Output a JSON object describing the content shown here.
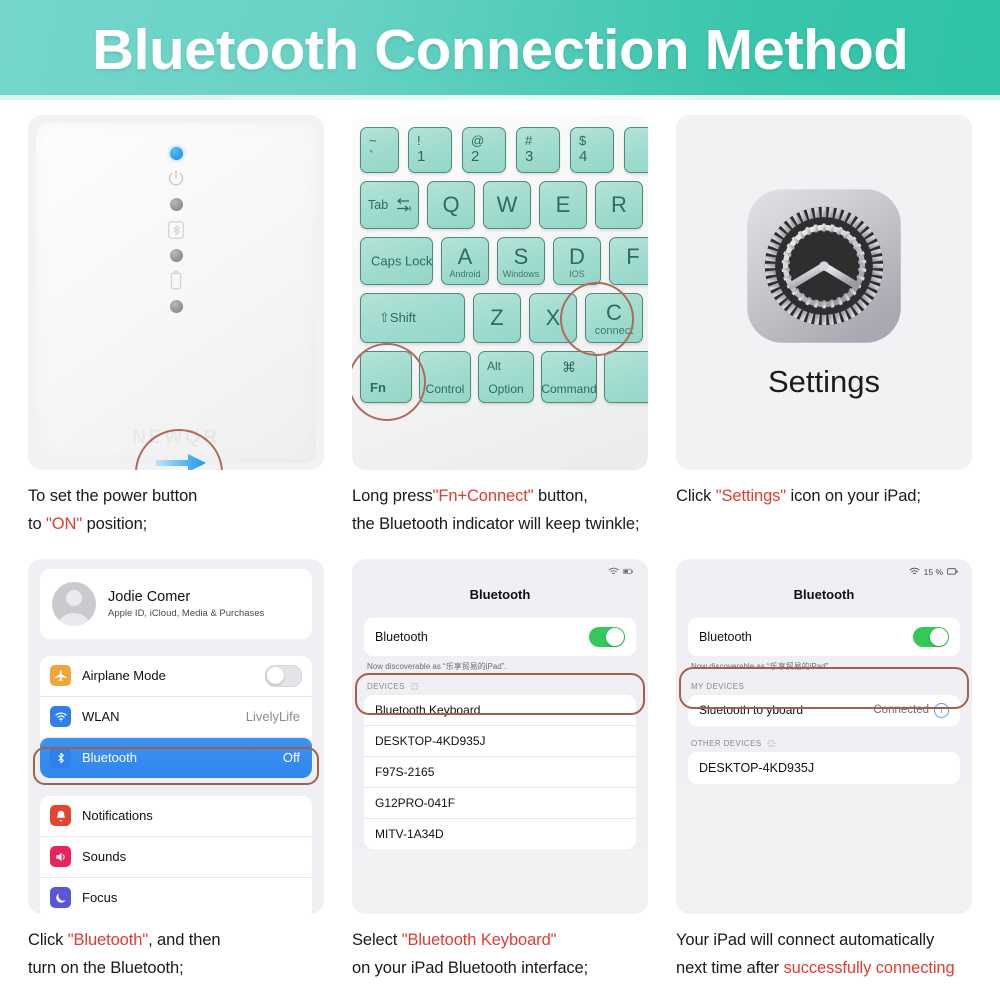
{
  "header": {
    "title": "Bluetooth Connection Method",
    "bg_from": "#76d6cc",
    "bg_to": "#2ec3a6"
  },
  "steps": [
    {
      "id": "power-on",
      "caption_lines": [
        [
          {
            "t": "To set the power button",
            "hl": false
          }
        ],
        [
          {
            "t": "to ",
            "hl": false
          },
          {
            "t": "\"ON\"",
            "hl": true
          },
          {
            "t": " position;",
            "hl": false
          }
        ]
      ]
    },
    {
      "id": "fn-connect",
      "caption_lines": [
        [
          {
            "t": "Long press",
            "hl": false
          },
          {
            "t": "\"Fn+Connect\"",
            "hl": true
          },
          {
            "t": " button,",
            "hl": false
          }
        ],
        [
          {
            "t": "the Bluetooth indicator will keep twinkle;",
            "hl": false
          }
        ]
      ]
    },
    {
      "id": "open-settings",
      "caption_lines": [
        [
          {
            "t": "Click ",
            "hl": false
          },
          {
            "t": "\"Settings\"",
            "hl": true
          },
          {
            "t": " icon on your iPad;",
            "hl": false
          }
        ]
      ]
    },
    {
      "id": "turn-on-bluetooth",
      "caption_lines": [
        [
          {
            "t": "Click ",
            "hl": false
          },
          {
            "t": "\"Bluetooth\"",
            "hl": true
          },
          {
            "t": ", and then",
            "hl": false
          }
        ],
        [
          {
            "t": "turn on the Bluetooth;",
            "hl": false
          }
        ]
      ]
    },
    {
      "id": "select-keyboard",
      "caption_lines": [
        [
          {
            "t": "Select ",
            "hl": false
          },
          {
            "t": "\"Bluetooth Keyboard\"",
            "hl": true
          }
        ],
        [
          {
            "t": "on your iPad Bluetooth interface;",
            "hl": false
          }
        ]
      ]
    },
    {
      "id": "auto-connect",
      "caption_lines": [
        [
          {
            "t": "Your iPad will connect automatically",
            "hl": false
          }
        ],
        [
          {
            "t": "next time after ",
            "hl": false
          },
          {
            "t": "successfully connecting",
            "hl": true
          }
        ]
      ]
    }
  ],
  "device_panel": {
    "led_on_color": "#1f9ae8",
    "leds": [
      "power-led-blue",
      "indicator-led-1",
      "indicator-led-2",
      "indicator-led-3"
    ],
    "icons": [
      "power-icon",
      "bluetooth-pair-icon",
      "battery-icon"
    ],
    "switch_state": "ON",
    "watermark": "NEWQR"
  },
  "keyboard": {
    "key_color": "#9fdbce",
    "rows": [
      [
        {
          "name": "key-tilde",
          "top": "~",
          "bottom": "`"
        },
        {
          "name": "key-1",
          "top": "!",
          "bottom": "1"
        },
        {
          "name": "key-2",
          "top": "@",
          "bottom": "2"
        },
        {
          "name": "key-3",
          "top": "#",
          "bottom": "3"
        },
        {
          "name": "key-4",
          "top": "$",
          "bottom": "4"
        }
      ],
      [
        {
          "name": "key-tab",
          "label": "Tab"
        },
        {
          "name": "key-q",
          "big": "Q"
        },
        {
          "name": "key-w",
          "big": "W"
        },
        {
          "name": "key-e",
          "big": "E"
        },
        {
          "name": "key-r",
          "big": "R"
        }
      ],
      [
        {
          "name": "key-caps-lock",
          "label": "Caps Lock"
        },
        {
          "name": "key-a",
          "big": "A",
          "sub": "Android"
        },
        {
          "name": "key-s",
          "big": "S",
          "sub": "Windows"
        },
        {
          "name": "key-d",
          "big": "D",
          "sub": "IOS"
        },
        {
          "name": "key-f",
          "big": "F"
        }
      ],
      [
        {
          "name": "key-shift",
          "label": "Shift"
        },
        {
          "name": "key-z",
          "big": "Z"
        },
        {
          "name": "key-x",
          "big": "X"
        },
        {
          "name": "key-c",
          "big": "C",
          "sub": "connect"
        }
      ],
      [
        {
          "name": "key-fn",
          "label": "Fn"
        },
        {
          "name": "key-control",
          "label": "Control"
        },
        {
          "name": "key-alt-option",
          "top": "Alt",
          "label": "Option"
        },
        {
          "name": "key-command",
          "top": "⌘",
          "label": "Command"
        },
        {
          "name": "key-space",
          "label": ""
        }
      ]
    ],
    "highlighted_keys": [
      "key-fn",
      "key-c"
    ],
    "highlight_color": "#b06a5c"
  },
  "settings_app": {
    "icon_name": "gear-icon",
    "label": "Settings"
  },
  "ios_settings": {
    "account": {
      "name": "Jodie Comer",
      "subtitle": "Apple ID, iCloud, Media & Purchases"
    },
    "group1": [
      {
        "name": "airplane-mode",
        "label": "Airplane Mode",
        "icon": "airplane-icon",
        "icon_color": "#f2a33c",
        "control": "toggle-off"
      },
      {
        "name": "wlan",
        "label": "WLAN",
        "icon": "wifi-icon",
        "icon_color": "#2f80ed",
        "value": "LivelyLife"
      },
      {
        "name": "bluetooth",
        "label": "Bluetooth",
        "icon": "bluetooth-icon",
        "icon_color": "#2f80ed",
        "value": "Off",
        "selected": true
      }
    ],
    "group2": [
      {
        "name": "notifications",
        "label": "Notifications",
        "icon": "bell-icon",
        "icon_color": "#e2462f"
      },
      {
        "name": "sounds",
        "label": "Sounds",
        "icon": "speaker-icon",
        "icon_color": "#e8255a"
      },
      {
        "name": "focus",
        "label": "Focus",
        "icon": "moon-icon",
        "icon_color": "#5b56d6"
      },
      {
        "name": "screen-time",
        "label": "",
        "icon": "hourglass-icon",
        "icon_color": "#5b56d6"
      }
    ],
    "highlight_color": "#a2604f",
    "selected_row_color": "#2f86ee"
  },
  "bluetooth_scan": {
    "status_icons": [
      "wifi-icon",
      "battery-icon"
    ],
    "title": "Bluetooth",
    "toggle_label": "Bluetooth",
    "toggle_on": true,
    "toggle_color": "#34c759",
    "discoverable_text": "Now discoverable as “乐享贸易的iPad”.",
    "section_header": "DEVICES",
    "devices": [
      {
        "name": "bluetooth-keyboard",
        "label": "Bluetooth Keyboard",
        "highlighted": true
      },
      {
        "name": "desktop-4kd935j",
        "label": "DESKTOP-4KD935J"
      },
      {
        "name": "f97s-2165",
        "label": "F97S-2165"
      },
      {
        "name": "g12pro-041f",
        "label": "G12PRO-041F"
      },
      {
        "name": "mitv-1a34d",
        "label": "MITV-1A34D"
      }
    ],
    "highlight_color": "#a2604f"
  },
  "bluetooth_connected": {
    "status_battery": "15 %",
    "title": "Bluetooth",
    "toggle_label": "Bluetooth",
    "toggle_on": true,
    "discoverable_text": "Now discoverable as “乐享贸易的iPad”.",
    "my_devices_header": "MY DEVICES",
    "my_devices": [
      {
        "name": "sluetooth-to-yboard",
        "label": "Sluetooth to yboard",
        "status": "Connected",
        "highlighted": true
      }
    ],
    "other_devices_header": "OTHER DEVICES",
    "other_devices": [
      {
        "name": "desktop-4kd935j",
        "label": "DESKTOP-4KD935J"
      }
    ],
    "highlight_color": "#a2604f"
  }
}
